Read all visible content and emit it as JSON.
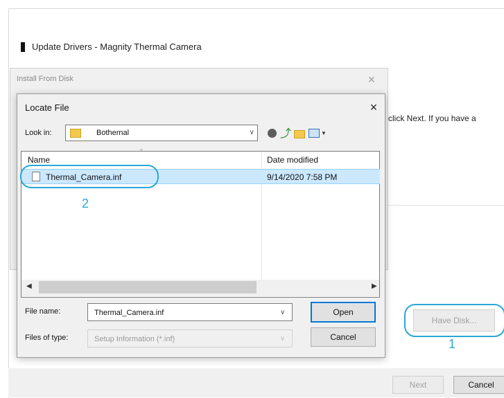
{
  "update_window": {
    "title": "Update Drivers - Magnity Thermal Camera",
    "side_text": "n click Next. If you have a",
    "have_disk_label": "Have Disk...",
    "next_label": "Next",
    "cancel_label": "Cancel"
  },
  "install_dialog": {
    "title": "Install From Disk",
    "close_glyph": "×"
  },
  "locate_dialog": {
    "title": "Locate File",
    "close_glyph": "×",
    "look_in_label": "Look in:",
    "look_in_value": "Bothernal",
    "columns": [
      "Name",
      "Date modified"
    ],
    "files": [
      {
        "name": "Thermal_Camera.inf",
        "date": "9/14/2020 7:58 PM"
      }
    ],
    "file_name_label": "File name:",
    "file_name_value": "Thermal_Camera.inf",
    "files_of_type_label": "Files of type:",
    "files_of_type_value": "Setup Information (*.inf)",
    "open_label": "Open",
    "cancel_label": "Cancel"
  },
  "annotations": {
    "step1": "1",
    "step2": "2"
  },
  "colors": {
    "annotation": "#29a6d9",
    "selection": "#cce8ff"
  }
}
